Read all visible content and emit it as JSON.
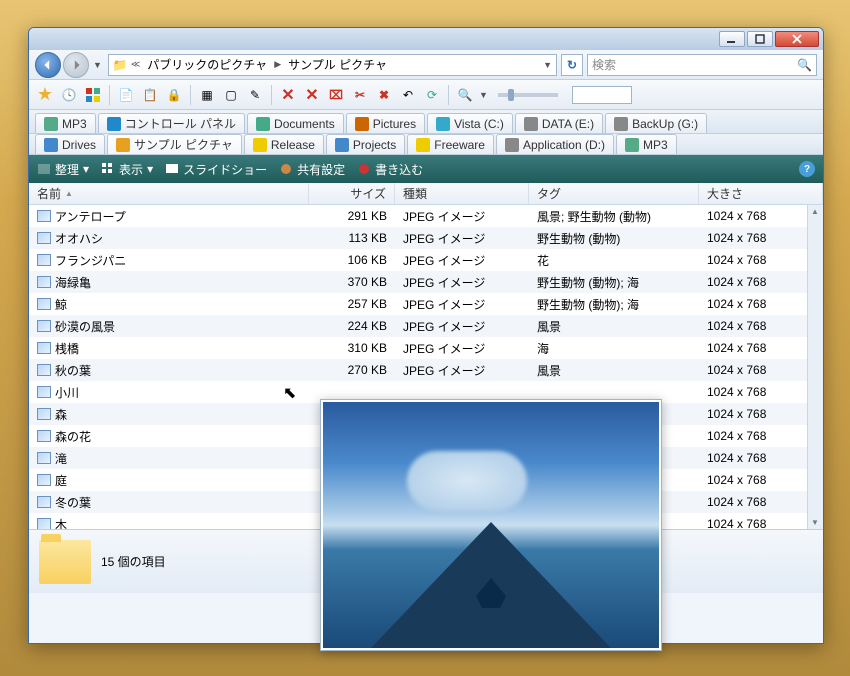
{
  "breadcrumb": {
    "seg1": "パブリックのピクチャ",
    "seg2": "サンプル ピクチャ"
  },
  "search": {
    "placeholder": "検索"
  },
  "tabs_row1": [
    {
      "icon": "#5a8",
      "label": "MP3"
    },
    {
      "icon": "#28c",
      "label": "コントロール パネル"
    },
    {
      "icon": "#4a8",
      "label": "Documents"
    },
    {
      "icon": "#c60",
      "label": "Pictures"
    },
    {
      "icon": "#3ac",
      "label": "Vista (C:)"
    },
    {
      "icon": "#888",
      "label": "DATA (E:)"
    },
    {
      "icon": "#888",
      "label": "BackUp (G:)"
    }
  ],
  "tabs_row2": [
    {
      "icon": "#48c",
      "label": "Drives"
    },
    {
      "icon": "#e8a020",
      "label": "サンプル ピクチャ",
      "active": true
    },
    {
      "icon": "#ec0",
      "label": "Release"
    },
    {
      "icon": "#48c",
      "label": "Projects"
    },
    {
      "icon": "#ec0",
      "label": "Freeware"
    },
    {
      "icon": "#888",
      "label": "Application (D:)"
    },
    {
      "icon": "#5a8",
      "label": "MP3"
    }
  ],
  "cmdbar": {
    "organize": "整理",
    "view": "表示",
    "slideshow": "スライドショー",
    "share": "共有設定",
    "burn": "書き込む"
  },
  "columns": {
    "name": "名前",
    "size": "サイズ",
    "type": "種類",
    "tag": "タグ",
    "dim": "大きさ"
  },
  "rows": [
    {
      "name": "アンテロープ",
      "size": "291 KB",
      "type": "JPEG イメージ",
      "tag": "風景; 野生動物 (動物)",
      "dim": "1024 x 768"
    },
    {
      "name": "オオハシ",
      "size": "113 KB",
      "type": "JPEG イメージ",
      "tag": "野生動物 (動物)",
      "dim": "1024 x 768"
    },
    {
      "name": "フランジパニ",
      "size": "106 KB",
      "type": "JPEG イメージ",
      "tag": "花",
      "dim": "1024 x 768"
    },
    {
      "name": "海緑亀",
      "size": "370 KB",
      "type": "JPEG イメージ",
      "tag": "野生動物 (動物); 海",
      "dim": "1024 x 768"
    },
    {
      "name": "鯨",
      "size": "257 KB",
      "type": "JPEG イメージ",
      "tag": "野生動物 (動物); 海",
      "dim": "1024 x 768"
    },
    {
      "name": "砂漠の風景",
      "size": "224 KB",
      "type": "JPEG イメージ",
      "tag": "風景",
      "dim": "1024 x 768"
    },
    {
      "name": "桟橋",
      "size": "310 KB",
      "type": "JPEG イメージ",
      "tag": "海",
      "dim": "1024 x 768"
    },
    {
      "name": "秋の葉",
      "size": "270 KB",
      "type": "JPEG イメージ",
      "tag": "風景",
      "dim": "1024 x 768"
    },
    {
      "name": "小川",
      "size": "",
      "type": "",
      "tag": "",
      "dim": "1024 x 768"
    },
    {
      "name": "森",
      "size": "",
      "type": "",
      "tag": "",
      "dim": "1024 x 768"
    },
    {
      "name": "森の花",
      "size": "",
      "type": "",
      "tag": "",
      "dim": "1024 x 768"
    },
    {
      "name": "滝",
      "size": "",
      "type": "",
      "tag": "",
      "dim": "1024 x 768"
    },
    {
      "name": "庭",
      "size": "",
      "type": "",
      "tag": "",
      "dim": "1024 x 768"
    },
    {
      "name": "冬の葉",
      "size": "",
      "type": "",
      "tag": "",
      "dim": "1024 x 768"
    },
    {
      "name": "木",
      "size": "",
      "type": "",
      "tag": "",
      "dim": "1024 x 768"
    }
  ],
  "status": {
    "count": "15 個の項目"
  }
}
